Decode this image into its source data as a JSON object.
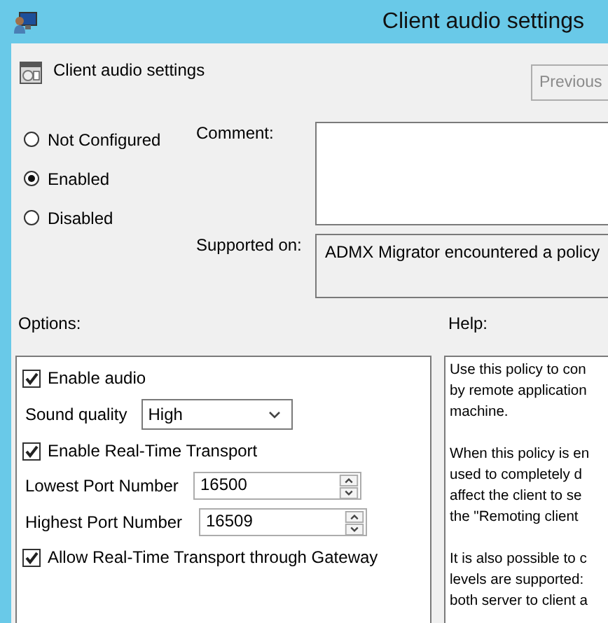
{
  "window": {
    "title": "Client audio settings"
  },
  "header": {
    "title": "Client audio settings",
    "previous_button": "Previous"
  },
  "state_options": [
    {
      "label": "Not Configured",
      "selected": false
    },
    {
      "label": "Enabled",
      "selected": true
    },
    {
      "label": "Disabled",
      "selected": false
    }
  ],
  "comment": {
    "label": "Comment:"
  },
  "supported_on": {
    "label": "Supported on:",
    "value": "ADMX Migrator encountered a policy"
  },
  "options": {
    "label": "Options:",
    "items": [
      {
        "kind": "checkbox",
        "label": "Enable audio",
        "checked": true
      },
      {
        "kind": "dropdown",
        "label": "Sound quality",
        "value": "High"
      },
      {
        "kind": "checkbox",
        "label": "Enable Real-Time Transport",
        "checked": true
      },
      {
        "kind": "spinner",
        "label": "Lowest Port Number",
        "value": "16500"
      },
      {
        "kind": "spinner",
        "label": "Highest Port Number",
        "value": "16509"
      },
      {
        "kind": "checkbox",
        "label": "Allow Real-Time Transport through Gateway",
        "checked": true
      }
    ]
  },
  "help": {
    "label": "Help:",
    "paragraphs": [
      [
        "Use this policy to con",
        "by remote application",
        "machine."
      ],
      [
        "When this policy is en",
        "used to completely d",
        "affect the client to se",
        "the \"Remoting client"
      ],
      [
        "It is also possible to c",
        "levels are supported:",
        "both server to client a"
      ]
    ]
  }
}
